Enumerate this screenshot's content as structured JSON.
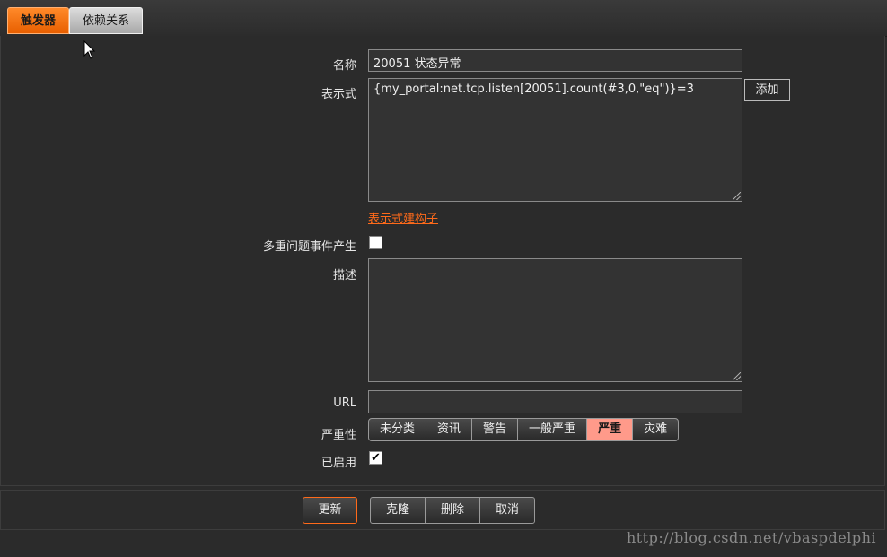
{
  "tabs": [
    {
      "label": "触发器"
    },
    {
      "label": "依赖关系"
    }
  ],
  "form": {
    "name_label": "名称",
    "name_value": "20051 状态异常",
    "expression_label": "表示式",
    "expression_value": "{my_portal:net.tcp.listen[20051].count(#3,0,\"eq\")}=3",
    "add_button": "添加",
    "expression_builder_link": "表示式建构子",
    "multiple_events_label": "多重问题事件产生",
    "description_label": "描述",
    "description_value": "",
    "url_label": "URL",
    "url_value": "",
    "severity_label": "严重性",
    "severity_options": [
      "未分类",
      "资讯",
      "警告",
      "一般严重",
      "严重",
      "灾难"
    ],
    "severity_selected": "严重",
    "enabled_label": "已启用"
  },
  "footer": {
    "update_button": "更新",
    "clone_button": "克隆",
    "delete_button": "删除",
    "cancel_button": "取消"
  },
  "watermark": "http://blog.csdn.net/vbaspdelphi",
  "colors": {
    "accent": "#ff6a1a",
    "selected_severity": "#ff9a8a"
  },
  "icons": {
    "cursor": "mouse-pointer-icon",
    "resize": "resize-grip-icon",
    "checkmark": "checkmark-icon"
  }
}
